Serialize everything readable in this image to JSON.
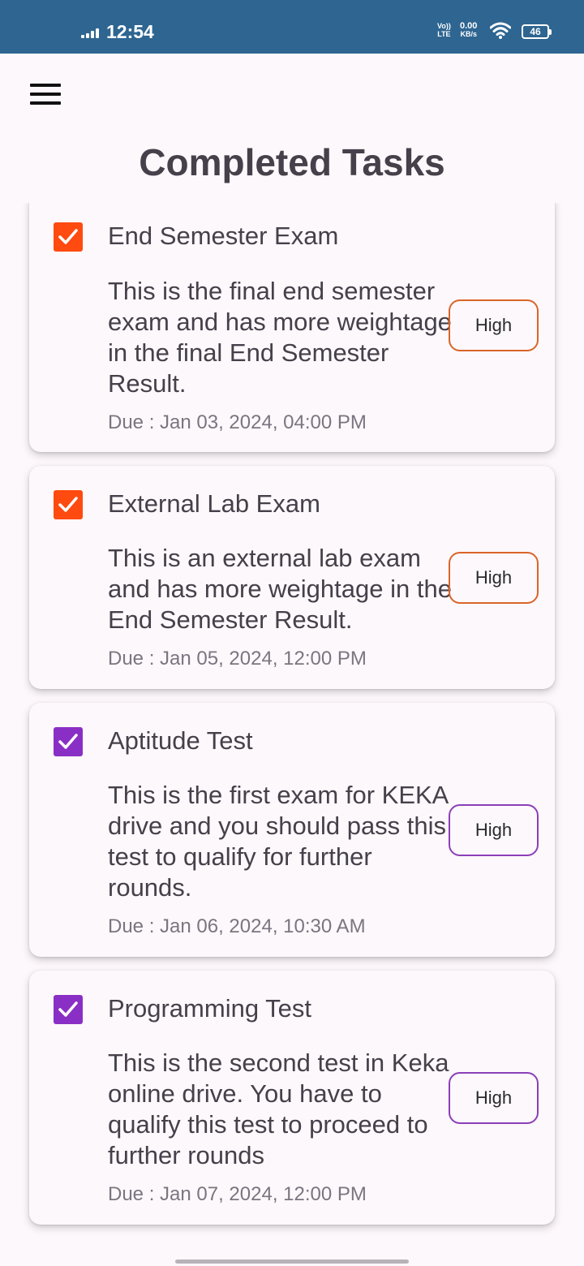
{
  "status_bar": {
    "time": "12:54",
    "volte_top": "Vo))",
    "volte_bottom": "LTE",
    "speed_value": "0.00",
    "speed_unit": "KB/s",
    "battery": "46"
  },
  "header": {
    "title": "Completed Tasks"
  },
  "colors": {
    "status_bar": "#2e6591",
    "orange": "#ff4a10",
    "orange_border": "#d9652a",
    "purple": "#8a2fc5",
    "purple_border": "#8b3fb8"
  },
  "tasks": [
    {
      "checked": true,
      "title": "End Semester Exam",
      "description": "This is the final end semester exam and has more weightage in the final End Semester Result.",
      "due": "Due : Jan 03, 2024, 04:00 PM",
      "priority": "High",
      "color": "orange"
    },
    {
      "checked": true,
      "title": "External Lab Exam",
      "description": "This is an external lab exam and has more weightage in the End Semester Result.",
      "due": "Due : Jan 05, 2024, 12:00 PM",
      "priority": "High",
      "color": "orange"
    },
    {
      "checked": true,
      "title": "Aptitude Test",
      "description": "This is the first exam for KEKA drive and you should pass this test to qualify for further rounds.",
      "due": "Due : Jan 06, 2024, 10:30 AM",
      "priority": "High",
      "color": "purple"
    },
    {
      "checked": true,
      "title": "Programming Test",
      "description": "This is the second test in Keka online drive. You have to qualify this test to proceed to further rounds",
      "due": "Due : Jan 07, 2024, 12:00 PM",
      "priority": "High",
      "color": "purple"
    }
  ]
}
